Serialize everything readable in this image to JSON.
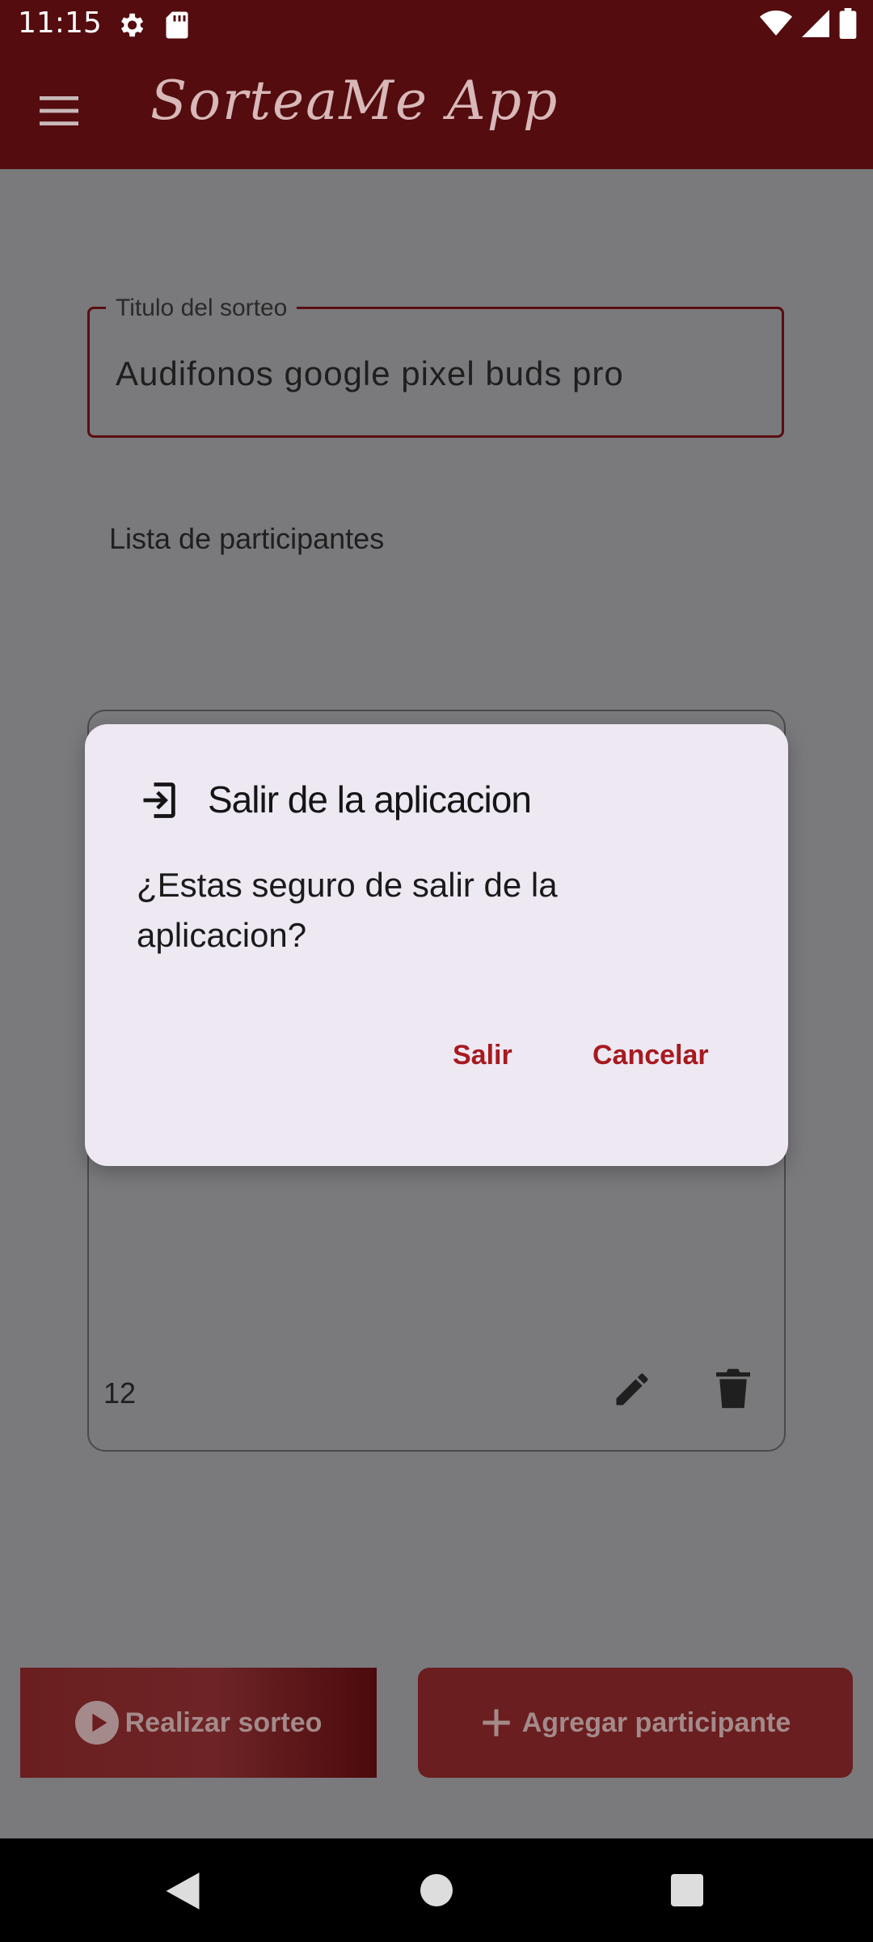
{
  "status_bar": {
    "time": "11:15"
  },
  "app_bar": {
    "title": "SorteaMe App"
  },
  "form": {
    "title_label": "Titulo del sorteo",
    "title_value": "Audifonos google pixel buds pro",
    "list_label": "Lista de participantes"
  },
  "participant_card": {
    "number": "12"
  },
  "buttons": {
    "sortear": "Realizar sorteo",
    "agregar": "Agregar participante"
  },
  "dialog": {
    "title": "Salir de la aplicacion",
    "message": "¿Estas seguro de salir de la aplicacion?",
    "confirm": "Salir",
    "cancel": "Cancelar"
  },
  "colors": {
    "app_bar": "#540c0f",
    "accent": "#a61a1f",
    "dialog_bg": "#eee8f3",
    "scrim": "#7a797c"
  }
}
